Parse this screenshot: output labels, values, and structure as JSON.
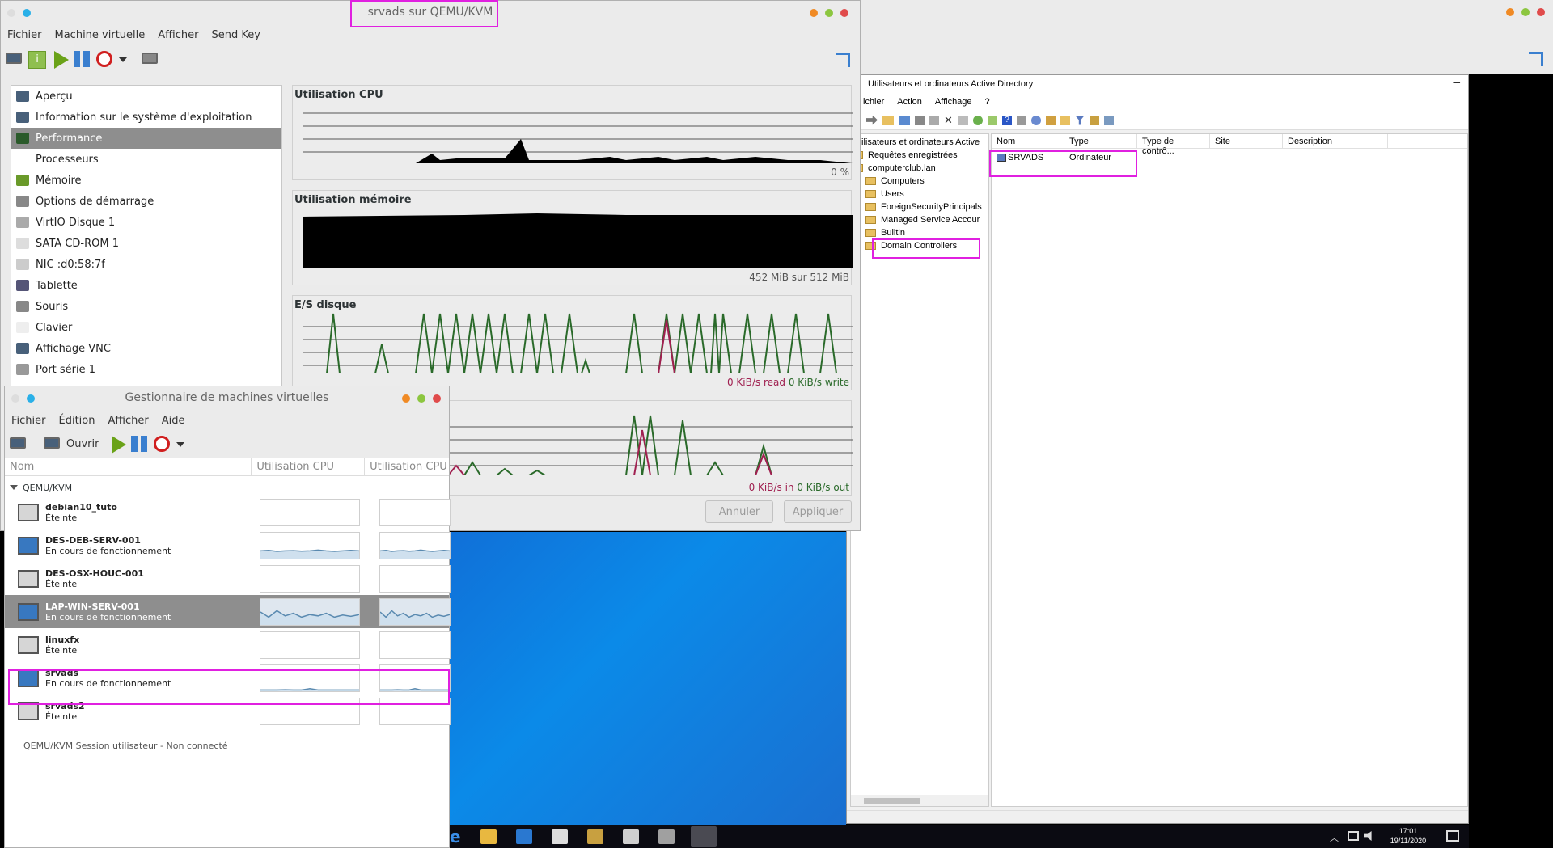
{
  "vm_window": {
    "title": "srvads sur QEMU/KVM",
    "menu": [
      "Fichier",
      "Machine virtuelle",
      "Afficher",
      "Send Key"
    ],
    "sidebar": [
      {
        "label": "Aperçu",
        "icon": "monitor-icon"
      },
      {
        "label": "Information sur le système d'exploitation",
        "icon": "monitor-icon"
      },
      {
        "label": "Performance",
        "icon": "chart-icon",
        "selected": true
      },
      {
        "label": "Processeurs",
        "icon": "cpu-icon"
      },
      {
        "label": "Mémoire",
        "icon": "memory-icon"
      },
      {
        "label": "Options de démarrage",
        "icon": "gear-icon"
      },
      {
        "label": "VirtIO Disque 1",
        "icon": "disk-icon"
      },
      {
        "label": "SATA CD-ROM 1",
        "icon": "cdrom-icon"
      },
      {
        "label": "NIC :d0:58:7f",
        "icon": "nic-icon"
      },
      {
        "label": "Tablette",
        "icon": "tablet-icon"
      },
      {
        "label": "Souris",
        "icon": "mouse-icon"
      },
      {
        "label": "Clavier",
        "icon": "keyboard-icon"
      },
      {
        "label": "Affichage VNC",
        "icon": "monitor-icon"
      },
      {
        "label": "Port série 1",
        "icon": "serial-icon"
      }
    ],
    "perf": {
      "cpu_title": "Utilisation CPU",
      "cpu_value": "0 %",
      "mem_title": "Utilisation mémoire",
      "mem_value": "452 MiB sur 512 MiB",
      "disk_title": "E/S disque",
      "disk_read": "0 KiB/s read",
      "disk_write": "0 KiB/s write",
      "net_in": "0 KiB/s in",
      "net_out": "0 KiB/s out"
    },
    "buttons": {
      "cancel": "Annuler",
      "apply": "Appliquer"
    }
  },
  "vmm_window": {
    "title": "Gestionnaire de machines virtuelles",
    "menu": [
      "Fichier",
      "Édition",
      "Afficher",
      "Aide"
    ],
    "open_label": "Ouvrir",
    "columns": [
      "Nom",
      "Utilisation CPU",
      "Utilisation CPU"
    ],
    "group": "QEMU/KVM",
    "vms": [
      {
        "name": "debian10_tuto",
        "state": "Éteinte",
        "running": false,
        "cpu": []
      },
      {
        "name": "DES-DEB-SERV-001",
        "state": "En cours de fonctionnement",
        "running": true,
        "cpu": [
          0.3,
          0.32,
          0.28,
          0.3,
          0.31,
          0.29,
          0.3,
          0.33,
          0.3,
          0.28,
          0.3,
          0.32,
          0.3
        ]
      },
      {
        "name": "DES-OSX-HOUC-001",
        "state": "Éteinte",
        "running": false,
        "cpu": []
      },
      {
        "name": "LAP-WIN-SERV-001",
        "state": "En cours de fonctionnement",
        "running": true,
        "selected": true,
        "cpu": [
          0.5,
          0.3,
          0.55,
          0.35,
          0.45,
          0.3,
          0.4,
          0.35,
          0.45,
          0.3,
          0.38,
          0.33,
          0.4
        ]
      },
      {
        "name": "linuxfx",
        "state": "Éteinte",
        "running": false,
        "cpu": []
      },
      {
        "name": "srvads",
        "state": "En cours de fonctionnement",
        "running": true,
        "highlight": true,
        "cpu": [
          0.05,
          0.05,
          0.05,
          0.06,
          0.05,
          0.05,
          0.1,
          0.05,
          0.05,
          0.05,
          0.05,
          0.05,
          0.05
        ]
      },
      {
        "name": "srvads2",
        "state": "Éteinte",
        "running": false,
        "cpu": []
      }
    ],
    "status": "QEMU/KVM Session utilisateur - Non connecté"
  },
  "ad_window": {
    "title": "Utilisateurs et ordinateurs Active Directory",
    "menu": [
      "ichier",
      "Action",
      "Affichage",
      "?"
    ],
    "tree": [
      {
        "label": "Utilisateurs et ordinateurs Active",
        "indent": 0
      },
      {
        "label": "Requêtes enregistrées",
        "indent": 1
      },
      {
        "label": "computerclub.lan",
        "indent": 1
      },
      {
        "label": "Computers",
        "indent": 2
      },
      {
        "label": "Users",
        "indent": 2
      },
      {
        "label": "ForeignSecurityPrincipals",
        "indent": 2
      },
      {
        "label": "Managed Service Accour",
        "indent": 2
      },
      {
        "label": "Builtin",
        "indent": 2
      },
      {
        "label": "Domain Controllers",
        "indent": 2,
        "highlight": true
      }
    ],
    "columns": [
      "Nom",
      "Type",
      "Type de contrô...",
      "Site",
      "Description"
    ],
    "rows": [
      {
        "name": "SRVADS",
        "type": "Ordinateur"
      }
    ]
  },
  "taskbar": {
    "time": "17:01",
    "date": "19/11/2020"
  }
}
